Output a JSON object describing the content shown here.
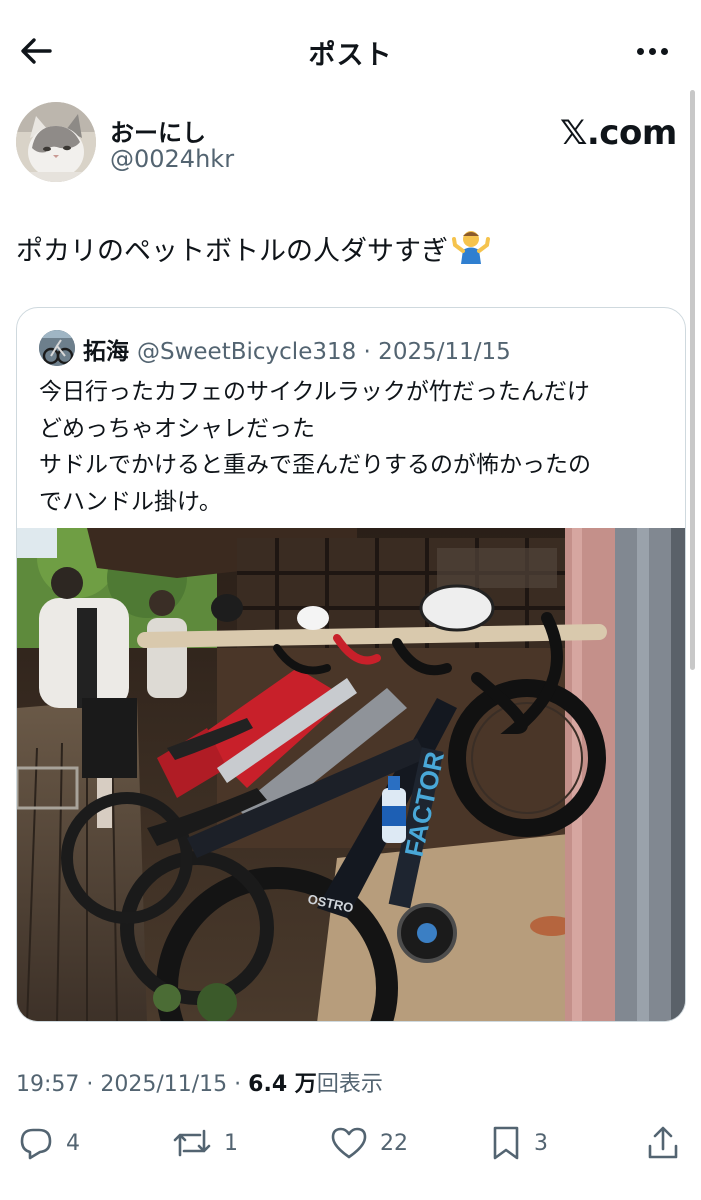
{
  "header": {
    "title": "ポスト",
    "back_icon": "arrow-left-icon",
    "more_icon": "more-horizontal-icon"
  },
  "post": {
    "author": {
      "name": "おーにし",
      "handle": "@0024hkr",
      "avatar": "cat-avatar"
    },
    "watermark": "𝕏.com",
    "text": "ポカリのペットボトルの人ダサすぎ",
    "emoji": "🤷‍♂️",
    "timestamp": "19:57 · 2025/11/15 · ",
    "views_number": "6.4 万",
    "views_label": "回表示"
  },
  "quote": {
    "author": {
      "name": "拓海",
      "handle": "@SweetBicycle318",
      "date": " · 2025/11/15"
    },
    "lines": [
      "今日行ったカフェのサイクルラックが竹だったんだけ",
      "どめっちゃオシャレだった",
      "サドルでかけると重みで歪んだりするのが怖かったの",
      "でハンドル掛け。"
    ],
    "image": {
      "subject": "road-bikes-hanging-on-bamboo-rack",
      "bike_frame_text": "FACTOR",
      "crank_text": "OSTRO"
    }
  },
  "actions": {
    "replies": "4",
    "reposts": "1",
    "likes": "22",
    "bookmarks": "3"
  },
  "colors": {
    "text": "#0f1419",
    "secondary": "#536471",
    "border": "#cfd9de"
  }
}
